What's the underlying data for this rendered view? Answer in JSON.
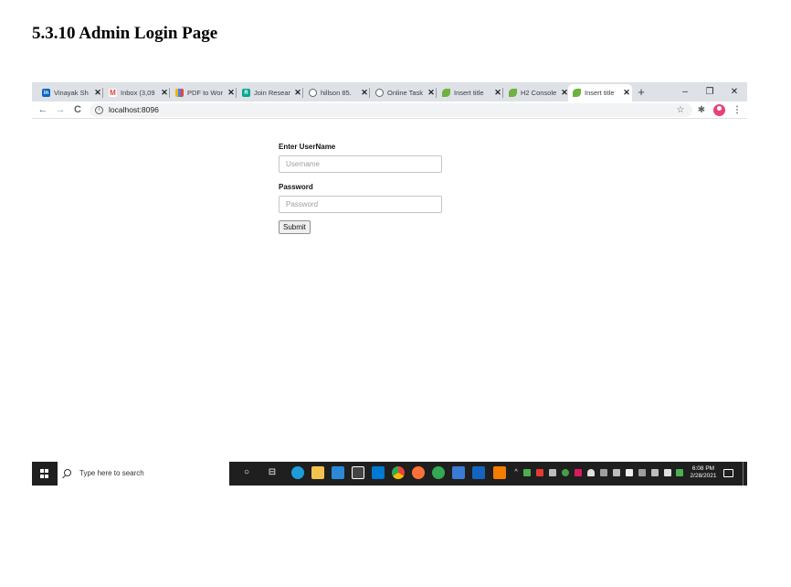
{
  "document": {
    "heading": "5.3.10 Admin Login Page"
  },
  "browser": {
    "tabs": [
      {
        "label": "Vinayak Sh",
        "icon": "linkedin-icon",
        "color": "#0a66c2",
        "active": false
      },
      {
        "label": "Inbox (3,09",
        "icon": "gmail-icon",
        "color": "#ea4335",
        "active": false
      },
      {
        "label": "PDF to Wor",
        "icon": "pdf-converter-icon",
        "color": "#f4b400",
        "active": false
      },
      {
        "label": "Join Resear",
        "icon": "research-icon",
        "color": "#00a88f",
        "active": false
      },
      {
        "label": "hillson 85.",
        "icon": "globe-icon",
        "color": "#5f6368",
        "active": false
      },
      {
        "label": "Online Task",
        "icon": "globe-icon",
        "color": "#5f6368",
        "active": false
      },
      {
        "label": "Insert title",
        "icon": "spring-leaf-icon",
        "color": "#6db33f",
        "active": false
      },
      {
        "label": "H2 Console",
        "icon": "spring-leaf-icon",
        "color": "#6db33f",
        "active": false
      },
      {
        "label": "Insert title",
        "icon": "spring-leaf-icon",
        "color": "#6db33f",
        "active": true
      }
    ],
    "close_glyph": "✕",
    "new_tab_glyph": "+",
    "window_controls": {
      "minimize": "–",
      "restore": "❐",
      "close": "✕"
    },
    "nav": {
      "back": "←",
      "forward": "→",
      "reload": "C"
    },
    "info_glyph": "i",
    "url": "localhost:8096",
    "toolbar_icons": {
      "star": "☆",
      "extensions": "✱",
      "menu": "⋮"
    }
  },
  "login": {
    "username_label": "Enter UserName",
    "username_placeholder": "Username",
    "username_value": "",
    "password_label": "Password",
    "password_placeholder": "Password",
    "password_value": "",
    "submit_label": "Submit"
  },
  "taskbar": {
    "search_placeholder": "Type here to search",
    "clock_time": "6:08 PM",
    "clock_date": "2/28/2021",
    "pinned_apps": [
      {
        "icon": "cortana-icon",
        "color": "transparent"
      },
      {
        "icon": "task-view-icon",
        "color": "transparent"
      },
      {
        "icon": "edge-icon",
        "color": "#1f9cd7"
      },
      {
        "icon": "file-explorer-icon",
        "color": "#f2c14e"
      },
      {
        "icon": "media-player-icon",
        "color": "#2b88d8"
      },
      {
        "icon": "store-icon",
        "color": "#444444"
      },
      {
        "icon": "mail-icon",
        "color": "#0078d4"
      },
      {
        "icon": "chrome-icon",
        "color": "#4caf50"
      },
      {
        "icon": "firefox-icon",
        "color": "#ff7139"
      },
      {
        "icon": "chrome-profile-icon",
        "color": "#34a853"
      },
      {
        "icon": "screenshot-tool-icon",
        "color": "#3a7bd5"
      },
      {
        "icon": "notes-icon",
        "color": "#1565c0"
      },
      {
        "icon": "app-icon",
        "color": "#f57c00"
      }
    ]
  },
  "colors": {
    "tabstrip_bg": "#dee1e6",
    "taskbar_bg": "#1f1f1f",
    "avatar": "#e8417a"
  }
}
